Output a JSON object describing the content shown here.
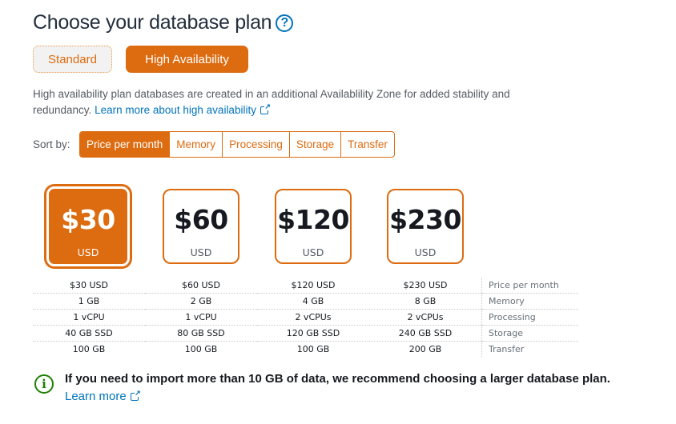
{
  "header": {
    "title": "Choose your database plan",
    "help_icon": "?"
  },
  "plan_type": {
    "options": [
      {
        "label": "Standard",
        "selected": false
      },
      {
        "label": "High Availability",
        "selected": true
      }
    ]
  },
  "description": {
    "text": "High availability plan databases are created in an additional Availablility Zone for added stability and redundancy.",
    "link": "Learn more about high availability"
  },
  "sort": {
    "label": "Sort by:",
    "tabs": [
      {
        "label": "Price per month",
        "active": true
      },
      {
        "label": "Memory",
        "active": false
      },
      {
        "label": "Processing",
        "active": false
      },
      {
        "label": "Storage",
        "active": false
      },
      {
        "label": "Transfer",
        "active": false
      }
    ]
  },
  "plans": [
    {
      "price": "$30",
      "currency": "USD",
      "selected": true
    },
    {
      "price": "$60",
      "currency": "USD",
      "selected": false
    },
    {
      "price": "$120",
      "currency": "USD",
      "selected": false
    },
    {
      "price": "$230",
      "currency": "USD",
      "selected": false
    }
  ],
  "specs": {
    "rows": [
      {
        "label": "Price per month",
        "values": [
          "$30 USD",
          "$60 USD",
          "$120 USD",
          "$230 USD"
        ]
      },
      {
        "label": "Memory",
        "values": [
          "1 GB",
          "2 GB",
          "4 GB",
          "8 GB"
        ]
      },
      {
        "label": "Processing",
        "values": [
          "1 vCPU",
          "1 vCPU",
          "2 vCPUs",
          "2 vCPUs"
        ]
      },
      {
        "label": "Storage",
        "values": [
          "40 GB SSD",
          "80 GB SSD",
          "120 GB SSD",
          "240 GB SSD"
        ]
      },
      {
        "label": "Transfer",
        "values": [
          "100 GB",
          "100 GB",
          "100 GB",
          "200 GB"
        ]
      }
    ]
  },
  "notice": {
    "icon": "i",
    "text": "If you need to import more than 10 GB of data, we recommend choosing a larger database plan.",
    "link": "Learn more"
  },
  "colors": {
    "accent": "#dd6b10",
    "link": "#0073bb",
    "success": "#1d8102"
  }
}
